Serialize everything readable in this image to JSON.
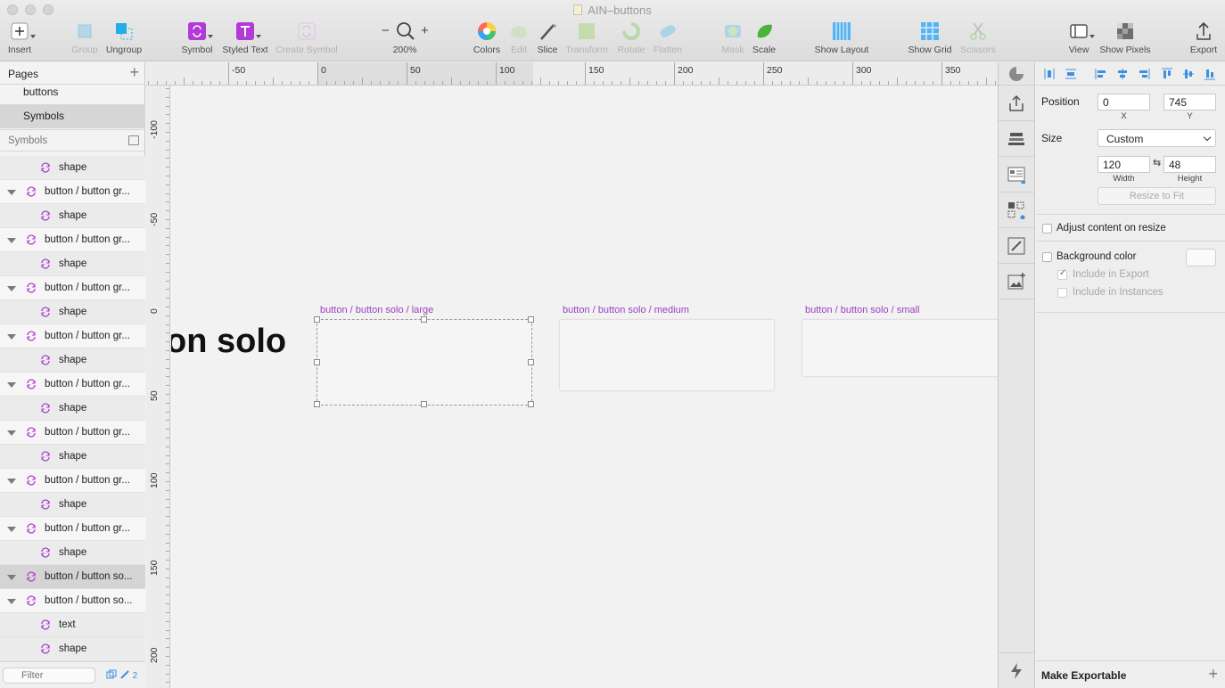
{
  "window": {
    "title": "AIN–buttons"
  },
  "toolbar": {
    "items": [
      {
        "label": "Insert",
        "icon": "plus-icon",
        "enabled": true
      },
      {
        "label": "Group",
        "icon": "group-icon",
        "enabled": false
      },
      {
        "label": "Ungroup",
        "icon": "ungroup-icon",
        "enabled": true
      },
      {
        "label": "Symbol",
        "icon": "symbol-icon",
        "enabled": true
      },
      {
        "label": "Styled Text",
        "icon": "styled-text-icon",
        "enabled": true
      },
      {
        "label": "Create Symbol",
        "icon": "create-symbol-icon",
        "enabled": false
      },
      {
        "label": "200%",
        "icon": "zoom-icon",
        "enabled": true
      },
      {
        "label": "Colors",
        "icon": "colors-icon",
        "enabled": true
      },
      {
        "label": "Edit",
        "icon": "edit-icon",
        "enabled": false
      },
      {
        "label": "Slice",
        "icon": "slice-icon",
        "enabled": true
      },
      {
        "label": "Transform",
        "icon": "transform-icon",
        "enabled": false
      },
      {
        "label": "Rotate",
        "icon": "rotate-icon",
        "enabled": false
      },
      {
        "label": "Flatten",
        "icon": "flatten-icon",
        "enabled": false
      },
      {
        "label": "Mask",
        "icon": "mask-icon",
        "enabled": false
      },
      {
        "label": "Scale",
        "icon": "scale-icon",
        "enabled": true
      },
      {
        "label": "Show Layout",
        "icon": "layout-icon",
        "enabled": true
      },
      {
        "label": "Show Grid",
        "icon": "grid-icon",
        "enabled": true
      },
      {
        "label": "Scissors",
        "icon": "scissors-icon",
        "enabled": false
      },
      {
        "label": "View",
        "icon": "view-icon",
        "enabled": true
      },
      {
        "label": "Show Pixels",
        "icon": "pixels-icon",
        "enabled": true
      },
      {
        "label": "Export",
        "icon": "export-icon",
        "enabled": true
      }
    ],
    "zoom_minus": "−",
    "zoom_plus": "+"
  },
  "sidebar": {
    "pages_title": "Pages",
    "pages": [
      {
        "label": "buttons",
        "selected": false
      },
      {
        "label": "Symbols",
        "selected": true
      }
    ],
    "symbols_title": "Symbols",
    "layers": [
      {
        "label": "shape",
        "kind": "child",
        "selected": false
      },
      {
        "label": "button / button gr...",
        "kind": "group",
        "selected": false
      },
      {
        "label": "shape",
        "kind": "child",
        "selected": false
      },
      {
        "label": "button / button gr...",
        "kind": "group",
        "selected": false
      },
      {
        "label": "shape",
        "kind": "child",
        "selected": false
      },
      {
        "label": "button / button gr...",
        "kind": "group",
        "selected": false
      },
      {
        "label": "shape",
        "kind": "child",
        "selected": false
      },
      {
        "label": "button / button gr...",
        "kind": "group",
        "selected": false
      },
      {
        "label": "shape",
        "kind": "child",
        "selected": false
      },
      {
        "label": "button / button gr...",
        "kind": "group",
        "selected": false
      },
      {
        "label": "shape",
        "kind": "child",
        "selected": false
      },
      {
        "label": "button / button gr...",
        "kind": "group",
        "selected": false
      },
      {
        "label": "shape",
        "kind": "child",
        "selected": false
      },
      {
        "label": "button / button gr...",
        "kind": "group",
        "selected": false
      },
      {
        "label": "shape",
        "kind": "child",
        "selected": false
      },
      {
        "label": "button / button gr...",
        "kind": "group",
        "selected": false
      },
      {
        "label": "shape",
        "kind": "child",
        "selected": false
      },
      {
        "label": "button / button so...",
        "kind": "group",
        "selected": true
      },
      {
        "label": "button / button so...",
        "kind": "group",
        "selected": false
      },
      {
        "label": "text",
        "kind": "child",
        "selected": false
      },
      {
        "label": "shape",
        "kind": "child",
        "selected": false
      }
    ],
    "filter_placeholder": "Filter",
    "footer_count": "2"
  },
  "rulers": {
    "h_labels": [
      "-50",
      "0",
      "50",
      "100",
      "150",
      "200",
      "250",
      "300",
      "350"
    ],
    "v_labels": [
      "-100",
      "-50",
      "0",
      "50",
      "100",
      "150",
      "200"
    ]
  },
  "canvas": {
    "big_text": "on solo",
    "artboards": [
      {
        "label": "button / button solo / large",
        "selected": true
      },
      {
        "label": "button / button solo / medium",
        "selected": false
      },
      {
        "label": "button / button solo / small",
        "selected": false
      }
    ]
  },
  "inspector": {
    "position_label": "Position",
    "x_value": "0",
    "y_value": "745",
    "x_label": "X",
    "y_label": "Y",
    "size_label": "Size",
    "size_preset": "Custom",
    "width_value": "120",
    "height_value": "48",
    "width_label": "Width",
    "height_label": "Height",
    "link_symbol": "⇆",
    "resize_to_fit": "Resize to Fit",
    "adjust_content_label": "Adjust content on resize",
    "adjust_content_checked": false,
    "background_color_label": "Background color",
    "background_color_checked": false,
    "include_in_export_label": "Include in Export",
    "include_in_export_checked": true,
    "include_in_instances_label": "Include in Instances",
    "include_in_instances_checked": false,
    "make_exportable": "Make Exportable"
  },
  "colors": {
    "accent": "#3d8fe0",
    "symbol_purple": "#b13bd6",
    "artboard_label": "#9b3fbf"
  }
}
